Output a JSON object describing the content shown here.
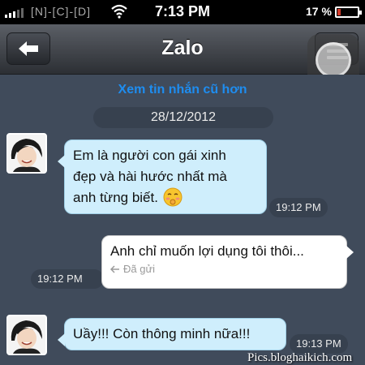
{
  "status_bar": {
    "carrier": "[N]-[C]-[D]",
    "time": "7:13 PM",
    "battery_percent": "17 %",
    "battery_level": 0.17,
    "icons": [
      "signal-icon",
      "wifi-icon",
      "battery-icon"
    ]
  },
  "nav": {
    "title": "Zalo",
    "back_icon": "arrow-left-icon",
    "menu_icon": "menu-icon"
  },
  "chat": {
    "load_older": "Xem tin nhắn cũ hơn",
    "date": "28/12/2012",
    "messages": [
      {
        "direction": "incoming",
        "lines": [
          "Em là người con gái xinh",
          "đẹp và hài hước nhất mà",
          "anh từng biết."
        ],
        "emoji": "🤭",
        "time": "19:12 PM"
      },
      {
        "direction": "outgoing",
        "lines": [
          "Anh chỉ muốn lợi dụng tôi thôi..."
        ],
        "status": "Đã gửi",
        "time": "19:12 PM"
      },
      {
        "direction": "incoming",
        "lines": [
          "Uầy!!! Còn thông minh nữa!!!"
        ],
        "time": "19:13 PM"
      }
    ]
  },
  "watermark": "Pics.bloghaikich.com",
  "colors": {
    "chat_background": "#404b5b",
    "incoming_bubble": "#cfeefc",
    "outgoing_bubble": "#ffffff",
    "link_blue": "#1e8df0"
  }
}
